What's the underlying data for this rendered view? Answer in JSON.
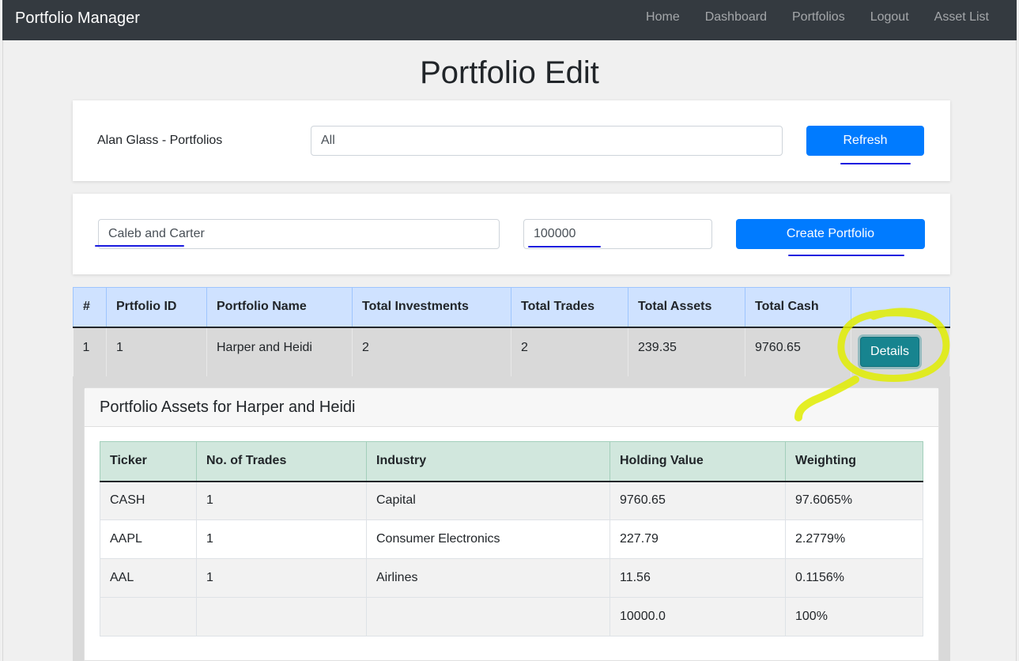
{
  "navbar": {
    "brand": "Portfolio Manager",
    "links": [
      "Home",
      "Dashboard",
      "Portfolios",
      "Logout",
      "Asset List"
    ]
  },
  "page_title": "Portfolio Edit",
  "filter_card": {
    "owner_label": "Alan Glass - Portfolios",
    "filter_value": "All",
    "refresh_label": "Refresh"
  },
  "create_card": {
    "name_value": "Caleb and Carter",
    "amount_value": "100000",
    "create_label": "Create Portfolio"
  },
  "portfolios_table": {
    "headers": [
      "#",
      "Prtfolio ID",
      "Portfolio Name",
      "Total Investments",
      "Total Trades",
      "Total Assets",
      "Total Cash",
      ""
    ],
    "rows": [
      {
        "index": "1",
        "id": "1",
        "name": "Harper and Heidi",
        "investments": "2",
        "trades": "2",
        "assets": "239.35",
        "cash": "9760.65",
        "action": "Details"
      }
    ]
  },
  "assets_panel": {
    "title": "Portfolio Assets for Harper and Heidi",
    "headers": [
      "Ticker",
      "No. of Trades",
      "Industry",
      "Holding Value",
      "Weighting"
    ],
    "rows": [
      {
        "ticker": "CASH",
        "trades": "1",
        "industry": "Capital",
        "value": "9760.65",
        "weight": "97.6065%"
      },
      {
        "ticker": "AAPL",
        "trades": "1",
        "industry": "Consumer Electronics",
        "value": "227.79",
        "weight": "2.2779%"
      },
      {
        "ticker": "AAL",
        "trades": "1",
        "industry": "Airlines",
        "value": "11.56",
        "weight": "0.1156%"
      }
    ],
    "total": {
      "value": "10000.0",
      "weight": "100%"
    }
  },
  "colors": {
    "navbar": "#343a40",
    "primary": "#007bff",
    "details": "#17848f",
    "table_header_blue": "#cfe2ff",
    "table_header_green": "#d1e7dd",
    "highlight_marker": "#e1ec00",
    "ink_underline": "#1a1adf"
  }
}
